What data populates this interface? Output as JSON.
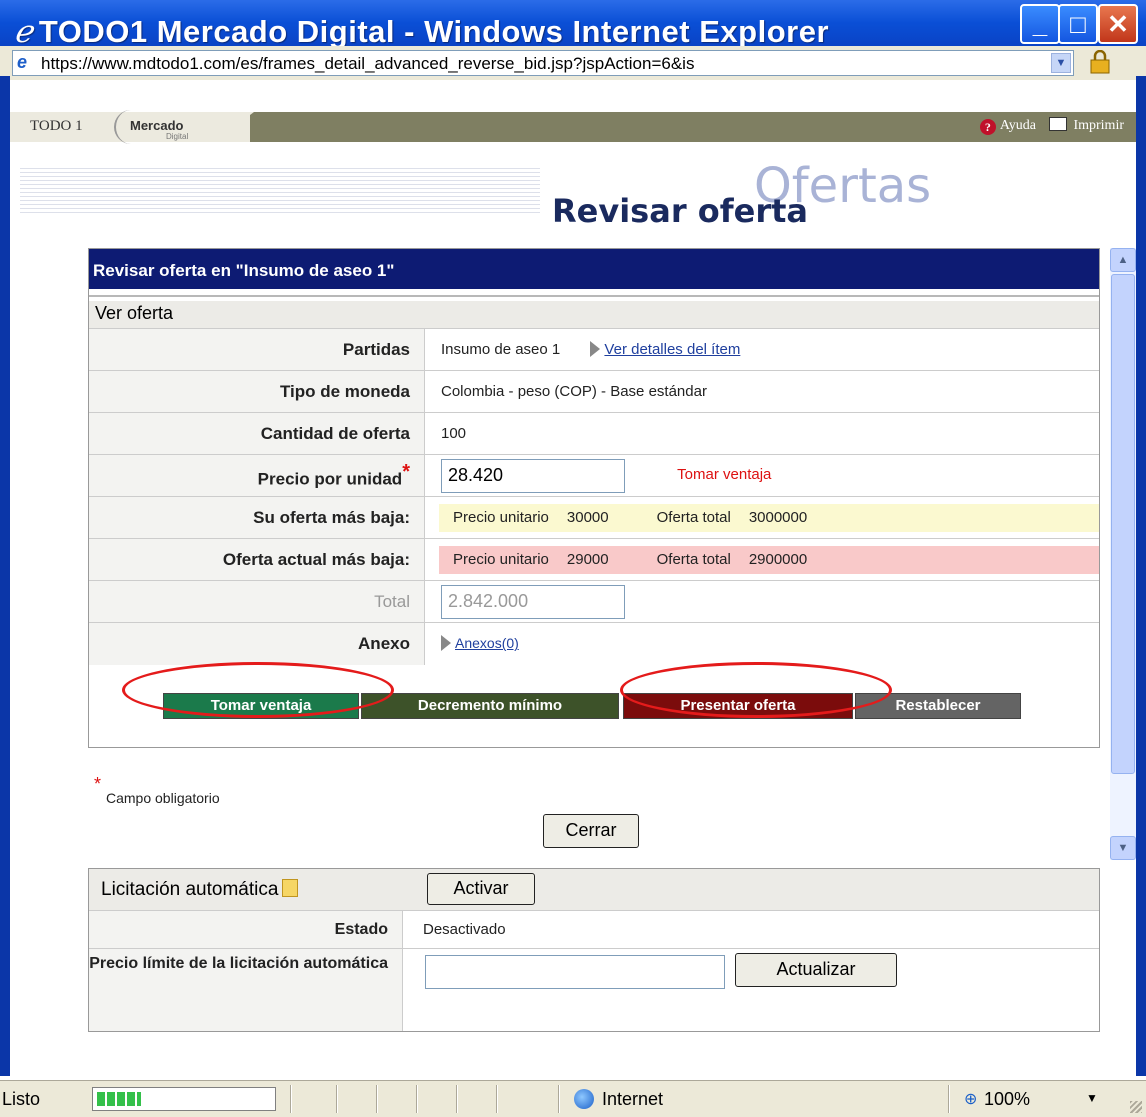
{
  "window": {
    "title": "TODO1 Mercado Digital - Windows Internet Explorer",
    "controls": [
      "minimize",
      "maximize",
      "close"
    ]
  },
  "address_bar": {
    "url": "https://www.mdtodo1.com/es/frames_detail_advanced_reverse_bid.jsp?jspAction=6&is"
  },
  "app_header": {
    "logo_main": "TODO 1",
    "logo_sub": "Mercado",
    "logo_sub2": "Digital",
    "help_label": "Ayuda",
    "print_label": "Imprimir"
  },
  "page": {
    "section_watermark": "Ofertas",
    "title": "Revisar oferta"
  },
  "panel": {
    "header": "Revisar oferta en \"Insumo de aseo 1\"",
    "subheader": "Ver oferta",
    "rows": {
      "partidas": {
        "label": "Partidas",
        "value": "Insumo de aseo 1",
        "link": "Ver detalles del ítem"
      },
      "moneda": {
        "label": "Tipo de moneda",
        "value": "Colombia - peso (COP) - Base estándar"
      },
      "cantidad": {
        "label": "Cantidad de oferta",
        "value": "100"
      },
      "precio": {
        "label": "Precio por unidad",
        "required_mark": "*",
        "value": "28.420",
        "hint": "Tomar ventaja"
      },
      "su_oferta": {
        "label": "Su oferta más baja:",
        "unit_label": "Precio unitario",
        "unit_value": "30000",
        "total_label": "Oferta total",
        "total_value": "3000000"
      },
      "actual": {
        "label": "Oferta actual más baja:",
        "unit_label": "Precio unitario",
        "unit_value": "29000",
        "total_label": "Oferta total",
        "total_value": "2900000"
      },
      "total": {
        "label": "Total",
        "value": "2.842.000"
      },
      "anexo": {
        "label": "Anexo",
        "link": "Anexos(0)"
      }
    },
    "buttons": {
      "tomar": "Tomar ventaja",
      "decremento": "Decremento mínimo",
      "presentar": "Presentar oferta",
      "restablecer": "Restablecer"
    },
    "colors": {
      "header_bg": "#0d1b73",
      "tomar_bg": "#1b7a4b",
      "decremento_bg": "#3d5229",
      "presentar_bg": "#7b0c0c",
      "restablecer_bg": "#646464",
      "annotation_ring": "#e41b1b"
    }
  },
  "required_note": {
    "mark": "*",
    "text": "Campo obligatorio"
  },
  "close_button": "Cerrar",
  "auto_bid": {
    "title": "Licitación automática",
    "activate_button": "Activar",
    "estado_label": "Estado",
    "estado_value": "Desactivado",
    "limit_label": "Precio límite de la licitación automática",
    "limit_value": "",
    "update_button": "Actualizar"
  },
  "status_bar": {
    "status": "Listo",
    "progress": 0.25,
    "zone": "Internet",
    "zoom": "100%"
  }
}
